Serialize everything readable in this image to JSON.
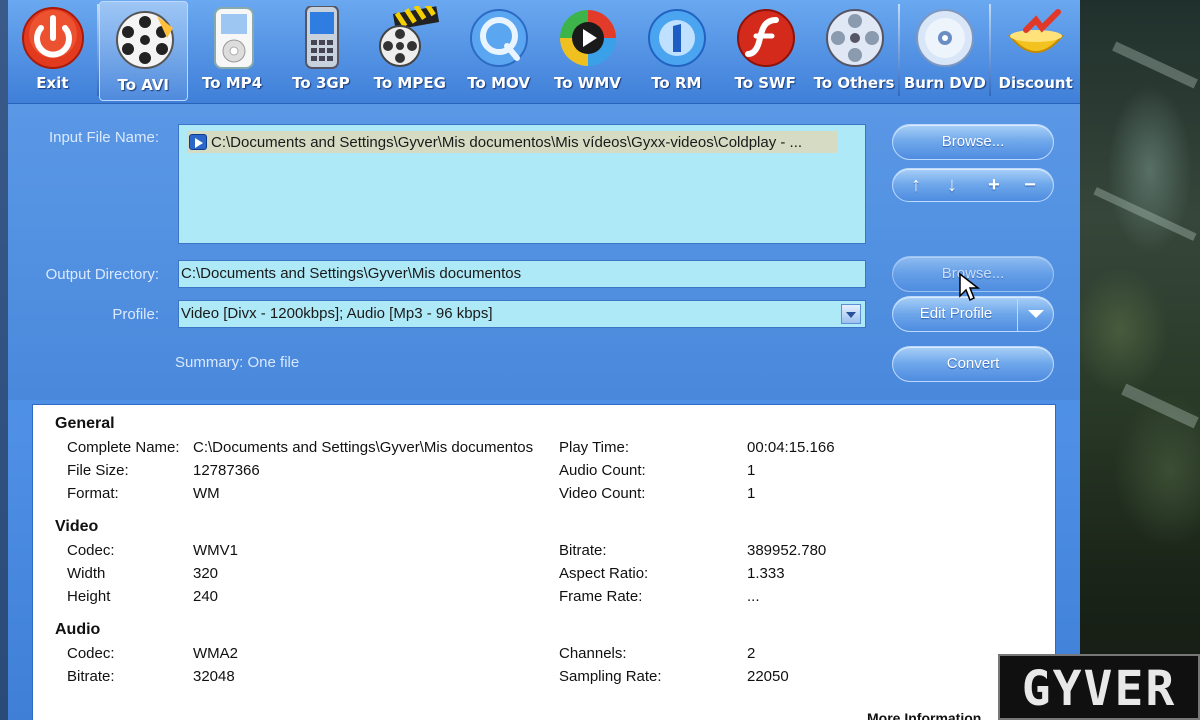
{
  "toolbar": {
    "buttons": [
      {
        "label": "Exit",
        "icon": "power-icon"
      },
      {
        "label": "To AVI",
        "icon": "film-reel-icon"
      },
      {
        "label": "To MP4",
        "icon": "mp4-player-icon"
      },
      {
        "label": "To 3GP",
        "icon": "mobile-phone-icon"
      },
      {
        "label": "To MPEG",
        "icon": "clapperboard-icon"
      },
      {
        "label": "To MOV",
        "icon": "quicktime-icon"
      },
      {
        "label": "To WMV",
        "icon": "windows-media-icon"
      },
      {
        "label": "To RM",
        "icon": "realmedia-icon"
      },
      {
        "label": "To SWF",
        "icon": "flash-icon"
      },
      {
        "label": "To Others",
        "icon": "reel-icon"
      },
      {
        "label": "Burn DVD",
        "icon": "dvd-disc-icon"
      },
      {
        "label": "Discount",
        "icon": "discount-bowl-icon"
      }
    ],
    "active": "To AVI"
  },
  "form": {
    "input_label": "Input File Name:",
    "input_files": [
      "C:\\Documents and Settings\\Gyver\\Mis documentos\\Mis vídeos\\Gyxx-videos\\Coldplay - ..."
    ],
    "output_label": "Output Directory:",
    "output_value": "C:\\Documents and Settings\\Gyver\\Mis documentos",
    "profile_label": "Profile:",
    "profile_value": "Video [Divx - 1200kbps]; Audio [Mp3 - 96 kbps]",
    "summary": "Summary: One file",
    "browse_label": "Browse...",
    "browse2_label": "Browse...",
    "edit_profile_label": "Edit Profile",
    "convert_label": "Convert",
    "order_buttons": [
      "↑",
      "↓",
      "+",
      "−"
    ]
  },
  "info": {
    "general_title": "General",
    "general": [
      {
        "k": "Complete Name:",
        "v": "C:\\Documents and Settings\\Gyver\\Mis documentos",
        "k2": "Play Time:",
        "v2": "00:04:15.166"
      },
      {
        "k": "File Size:",
        "v": "12787366",
        "k2": "Audio Count:",
        "v2": "1"
      },
      {
        "k": "Format:",
        "v": "WM",
        "k2": "Video Count:",
        "v2": "1"
      }
    ],
    "video_title": "Video",
    "video": [
      {
        "k": "Codec:",
        "v": "WMV1",
        "k2": "Bitrate:",
        "v2": "389952.780"
      },
      {
        "k": "Width",
        "v": "320",
        "k2": "Aspect Ratio:",
        "v2": "1.333"
      },
      {
        "k": "Height",
        "v": "240",
        "k2": "Frame Rate:",
        "v2": "..."
      }
    ],
    "audio_title": "Audio",
    "audio": [
      {
        "k": "Codec:",
        "v": "WMA2",
        "k2": "Channels:",
        "v2": "2"
      },
      {
        "k": "Bitrate:",
        "v": "32048",
        "k2": "Sampling Rate:",
        "v2": "22050"
      }
    ],
    "more_info": "More Information"
  },
  "watermark": "GYVER",
  "colors": {
    "window_blue": "#4a8ae0",
    "field_bg": "#aee9f7",
    "panel_bg": "#ffffff"
  }
}
